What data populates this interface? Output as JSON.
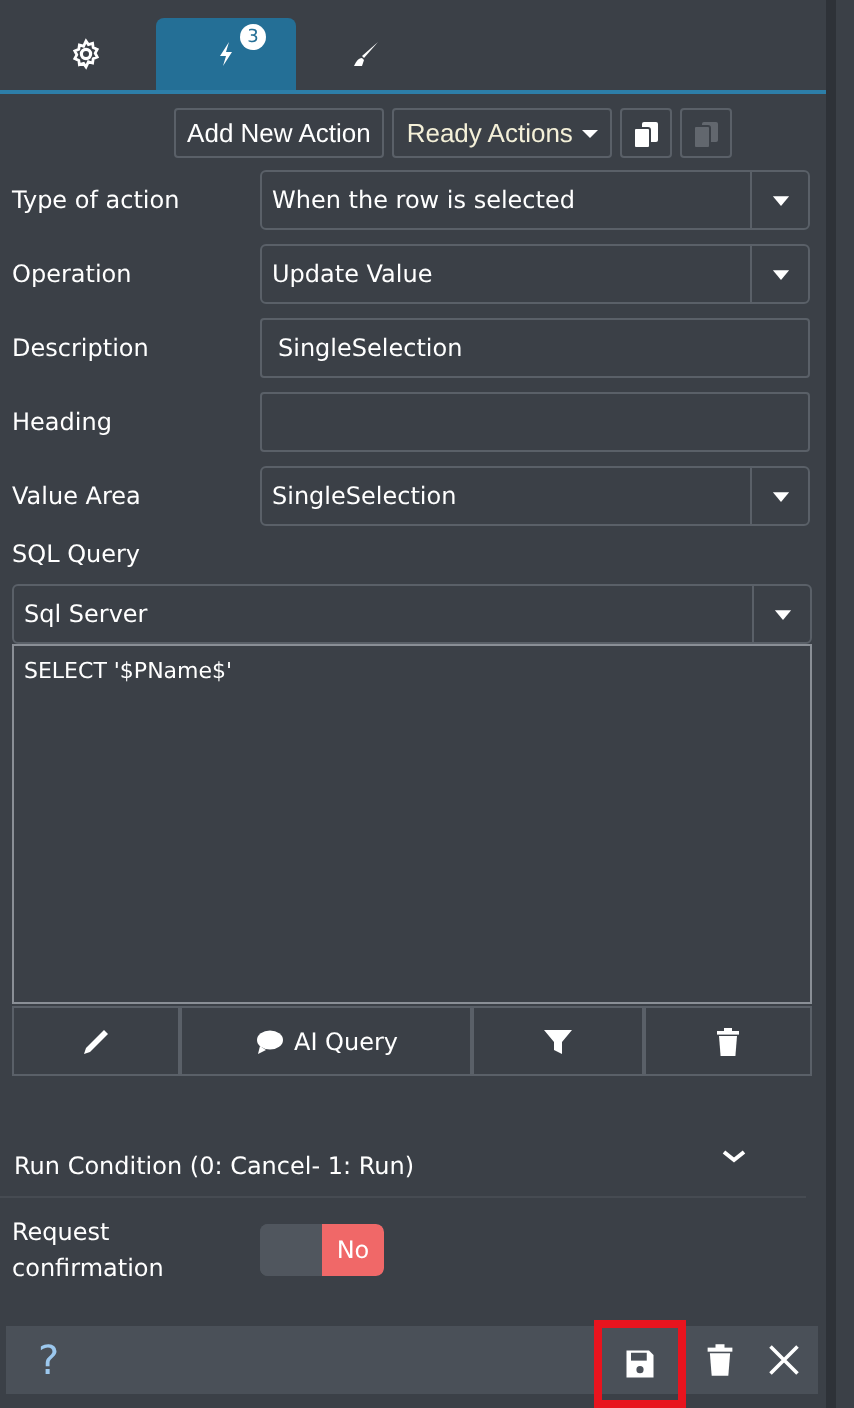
{
  "tabs": [
    {
      "selected": false
    },
    {
      "selected": true,
      "badge": "3"
    },
    {
      "selected": false
    }
  ],
  "toolbar": {
    "add_button": "Add New Action",
    "ready_button": "Ready Actions",
    "icon_buttons": [
      {
        "disabled": false
      },
      {
        "disabled": true
      }
    ]
  },
  "fields": [
    {
      "label": "Type of action",
      "kind": "select",
      "value": "When the row is selected"
    },
    {
      "label": "Operation",
      "kind": "select",
      "value": "Update Value"
    },
    {
      "label": "Description",
      "kind": "text",
      "value": "SingleSelection"
    },
    {
      "label": "Heading",
      "kind": "text"
    },
    {
      "label": "Value Area",
      "kind": "select",
      "value": "SingleSelection"
    }
  ],
  "sql": {
    "label": "SQL Query",
    "dialect": "Sql Server",
    "query": "SELECT '$PName$'",
    "ai_button": "AI Query"
  },
  "run_condition": {
    "label": "Run Condition (0: Cancel- 1: Run)",
    "expanded": false
  },
  "confirmation": {
    "label": "Request confirmation",
    "on": false,
    "state_label": "No"
  },
  "footer": {
    "help": "?",
    "buttons": [
      {
        "highlighted": true
      },
      {
        "highlighted": false
      },
      {
        "highlighted": false
      }
    ]
  }
}
